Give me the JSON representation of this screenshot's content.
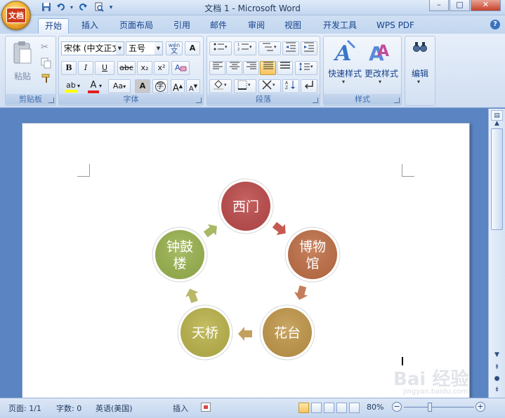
{
  "window": {
    "title": "文档 1 - Microsoft Word",
    "office_button_label": "文档",
    "controls": {
      "minimize": "–",
      "maximize": "□",
      "close": "✕"
    }
  },
  "quick_access": [
    "save-icon",
    "undo-icon",
    "redo-icon",
    "print-preview-icon",
    "customize-icon"
  ],
  "tabs": [
    {
      "label": "开始",
      "active": true
    },
    {
      "label": "插入",
      "active": false
    },
    {
      "label": "页面布局",
      "active": false
    },
    {
      "label": "引用",
      "active": false
    },
    {
      "label": "邮件",
      "active": false
    },
    {
      "label": "审阅",
      "active": false
    },
    {
      "label": "视图",
      "active": false
    },
    {
      "label": "开发工具",
      "active": false
    },
    {
      "label": "WPS PDF",
      "active": false
    }
  ],
  "ribbon": {
    "clipboard": {
      "group_label": "剪贴板",
      "paste_label": "粘贴"
    },
    "font": {
      "group_label": "字体",
      "font_name": "宋体 (中文正文)",
      "font_size": "五号",
      "bold": "B",
      "italic": "I",
      "underline": "U",
      "strike": "abc",
      "subscript": "x₂",
      "superscript": "x²",
      "change_case": "Aa",
      "grow": "A",
      "shrink": "A",
      "char_border": "A",
      "phonetic": "wén",
      "char_shading": "A",
      "enclose": "字",
      "font_color": "A",
      "highlight": "ab"
    },
    "paragraph": {
      "group_label": "段落"
    },
    "styles": {
      "group_label": "样式",
      "quick_styles": "快速样式",
      "change_styles": "更改样式"
    },
    "editing": {
      "label": "编辑"
    }
  },
  "diagram": {
    "nodes": [
      {
        "label": "西门",
        "color": "#bf4f4f"
      },
      {
        "label": "博物馆",
        "line1": "博物",
        "line2": "馆",
        "color": "#c1734a"
      },
      {
        "label": "花台",
        "color": "#c39a4e"
      },
      {
        "label": "天桥",
        "color": "#bdb54f"
      },
      {
        "label": "钟鼓楼",
        "line1": "钟鼓",
        "line2": "楼",
        "color": "#9db553"
      }
    ]
  },
  "status": {
    "page": "页面: 1/1",
    "words": "字数: 0",
    "language": "英语(美国)",
    "insert_mode": "插入",
    "zoom": "80%"
  },
  "watermark": {
    "text": "Bai 经验",
    "sub": "jingyan.baidu.com"
  }
}
